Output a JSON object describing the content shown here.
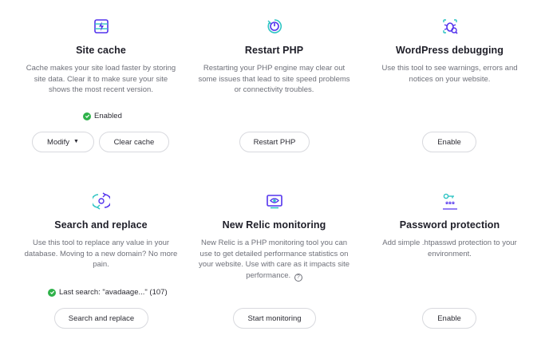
{
  "colors": {
    "accent": "#5333ed",
    "success": "#2fb24a",
    "text": "#1e1e28",
    "muted": "#6e7079"
  },
  "cards": {
    "site_cache": {
      "icon": "database-bolt-icon",
      "title": "Site cache",
      "description": "Cache makes your site load faster by storing site data. Clear it to make sure your site shows the most recent version.",
      "status": "Enabled",
      "modify_label": "Modify",
      "clear_label": "Clear cache"
    },
    "restart_php": {
      "icon": "power-restart-icon",
      "title": "Restart PHP",
      "description": "Restarting your PHP engine may clear out some issues that lead to site speed problems or connectivity troubles.",
      "button_label": "Restart PHP"
    },
    "wp_debugging": {
      "icon": "bug-icon",
      "title": "WordPress debugging",
      "description": "Use this tool to see warnings, errors and notices on your website.",
      "button_label": "Enable"
    },
    "search_replace": {
      "icon": "swap-arrows-icon",
      "title": "Search and replace",
      "description": "Use this tool to replace any value in your database. Moving to a new domain? No more pain.",
      "status": "Last search: \"avadaage...\" (107)",
      "button_label": "Search and replace"
    },
    "new_relic": {
      "icon": "monitor-eye-icon",
      "title": "New Relic monitoring",
      "description": "New Relic is a PHP monitoring tool you can use to get detailed performance statistics on your website. Use with care as it impacts site performance.",
      "help_glyph": "?",
      "button_label": "Start monitoring"
    },
    "password": {
      "icon": "key-password-icon",
      "title": "Password protection",
      "description": "Add simple .htpasswd protection to your environment.",
      "button_label": "Enable"
    }
  }
}
